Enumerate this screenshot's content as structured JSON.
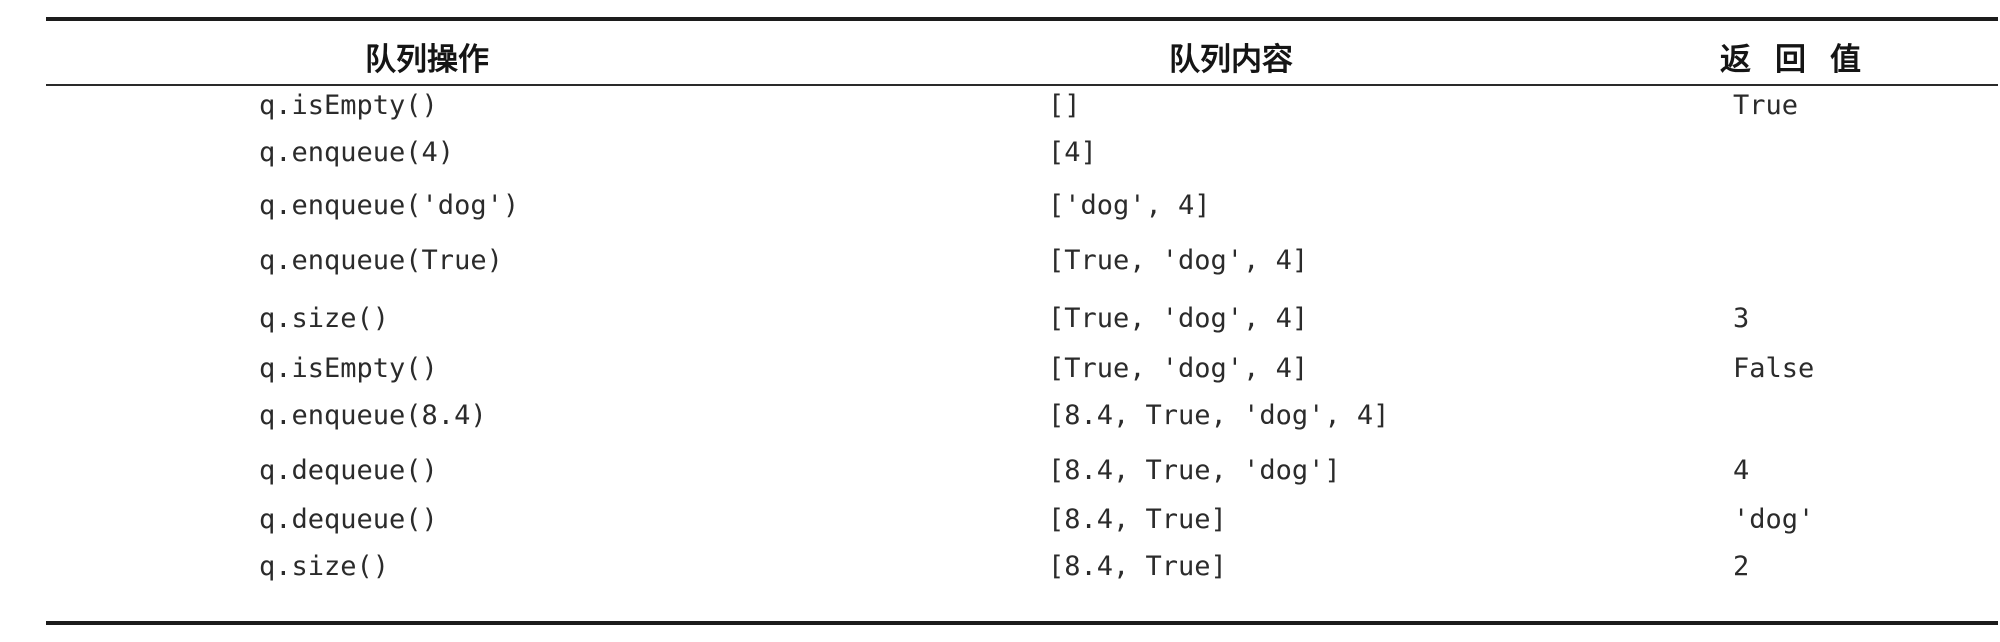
{
  "table": {
    "headers": {
      "operation": "队列操作",
      "content": "队列内容",
      "return_value": "返回值"
    },
    "rows": [
      {
        "operation": "q.isEmpty()",
        "content": "[]",
        "return_value": "True"
      },
      {
        "operation": "q.enqueue(4)",
        "content": "[4]",
        "return_value": ""
      },
      {
        "operation": "q.enqueue('dog')",
        "content": "['dog', 4]",
        "return_value": ""
      },
      {
        "operation": "q.enqueue(True)",
        "content": "[True, 'dog', 4]",
        "return_value": ""
      },
      {
        "operation": "q.size()",
        "content": "[True, 'dog', 4]",
        "return_value": "3"
      },
      {
        "operation": "q.isEmpty()",
        "content": "[True, 'dog', 4]",
        "return_value": "False"
      },
      {
        "operation": "q.enqueue(8.4)",
        "content": "[8.4, True, 'dog', 4]",
        "return_value": ""
      },
      {
        "operation": "q.dequeue()",
        "content": "[8.4, True, 'dog']",
        "return_value": "4"
      },
      {
        "operation": "q.dequeue()",
        "content": "[8.4, True]",
        "return_value": "'dog'"
      },
      {
        "operation": "q.size()",
        "content": "[8.4, True]",
        "return_value": "2"
      }
    ]
  }
}
